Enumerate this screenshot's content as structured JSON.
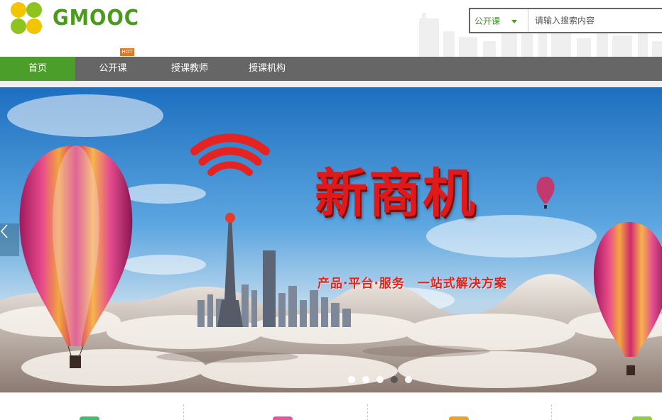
{
  "header": {
    "brand": "GMOOC",
    "search": {
      "scope": "公开课",
      "placeholder": "请输入搜索内容"
    }
  },
  "nav": {
    "items": [
      {
        "label": "首页",
        "active": true
      },
      {
        "label": "公开课",
        "active": false,
        "badge": "HOT"
      },
      {
        "label": "授课教师",
        "active": false
      },
      {
        "label": "授课机构",
        "active": false
      }
    ]
  },
  "banner": {
    "headline": "新商机",
    "tagline": "产品·平台·服务　一站式解决方案",
    "slide_count": 5,
    "active_slide": 4
  },
  "features": {
    "icon_colors": [
      "#3fbf6e",
      "#e8559a",
      "#f0a022",
      "#8ccf3c"
    ]
  },
  "colors": {
    "accent": "#4b9e2a",
    "nav_bg": "#666666",
    "hot": "#e8761c"
  }
}
